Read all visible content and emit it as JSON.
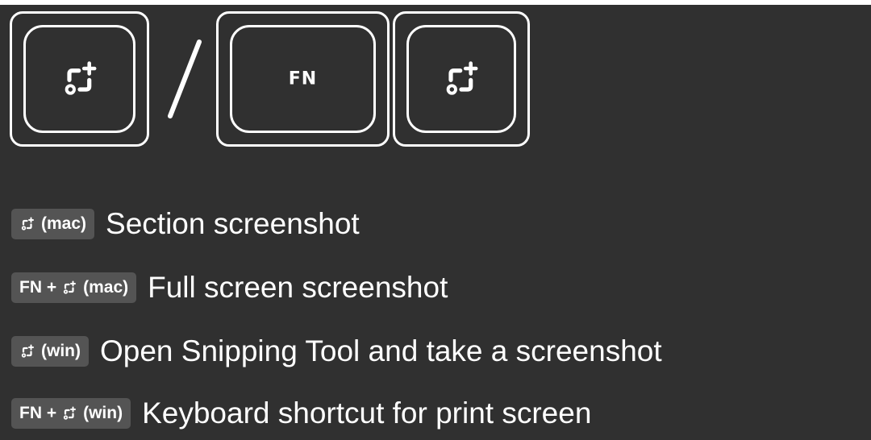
{
  "keys": [
    {
      "icon": "screenshot-icon"
    },
    {
      "label": "FN"
    },
    {
      "icon": "screenshot-icon"
    }
  ],
  "legend": [
    {
      "chip_prefix": "",
      "chip_suffix": "(mac)",
      "description": "Section screenshot"
    },
    {
      "chip_prefix": "FN +",
      "chip_suffix": "(mac)",
      "description": "Full screen screenshot"
    },
    {
      "chip_prefix": "",
      "chip_suffix": "(win)",
      "description": "Open Snipping Tool and take a screenshot"
    },
    {
      "chip_prefix": "FN +",
      "chip_suffix": "(win)",
      "description": "Keyboard shortcut for print screen"
    }
  ],
  "colors": {
    "background": "#303030",
    "key_outline": "#ffffff",
    "chip_background": "#545454",
    "text": "#ffffff"
  }
}
